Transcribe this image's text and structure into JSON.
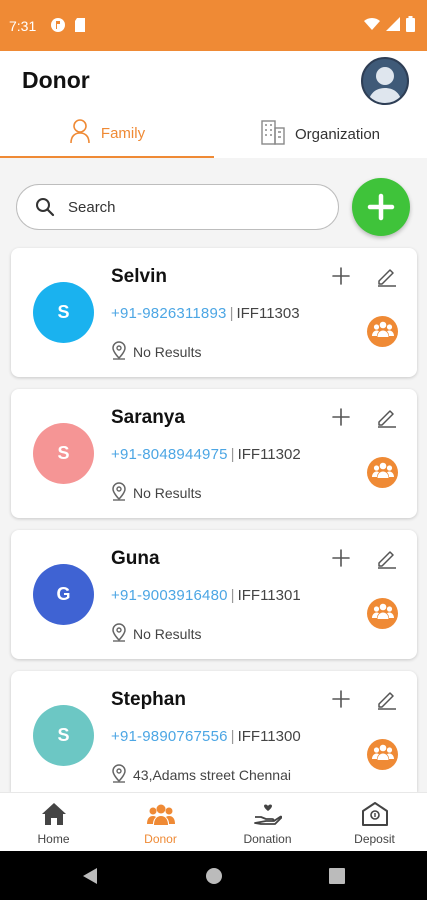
{
  "status_bar": {
    "time": "7:31"
  },
  "header": {
    "title": "Donor"
  },
  "tabs": [
    {
      "label": "Family",
      "icon": "person-icon",
      "active": true
    },
    {
      "label": "Organization",
      "icon": "building-icon",
      "active": false
    }
  ],
  "search": {
    "placeholder": "Search"
  },
  "donors": [
    {
      "initial": "S",
      "name": "Selvin",
      "phone": "+91-9826311893",
      "id": "IFF11303",
      "address": "No Results",
      "color": "#1ab2ef"
    },
    {
      "initial": "S",
      "name": "Saranya",
      "phone": "+91-8048944975",
      "id": "IFF11302",
      "address": "No Results",
      "color": "#f59595"
    },
    {
      "initial": "G",
      "name": "Guna",
      "phone": "+91-9003916480",
      "id": "IFF11301",
      "address": "No Results",
      "color": "#3f63d3"
    },
    {
      "initial": "S",
      "name": "Stephan",
      "phone": "+91-9890767556",
      "id": "IFF11300",
      "address": "43,Adams street Chennai",
      "color": "#6cc7c4"
    }
  ],
  "bottom_nav": [
    {
      "label": "Home",
      "icon": "home-icon",
      "active": false
    },
    {
      "label": "Donor",
      "icon": "donor-group-icon",
      "active": true
    },
    {
      "label": "Donation",
      "icon": "donation-hand-icon",
      "active": false
    },
    {
      "label": "Deposit",
      "icon": "deposit-bank-icon",
      "active": false
    }
  ],
  "colors": {
    "brand": "#ef8a35",
    "fab": "#3fc33a",
    "phone": "#4ca6e4"
  }
}
